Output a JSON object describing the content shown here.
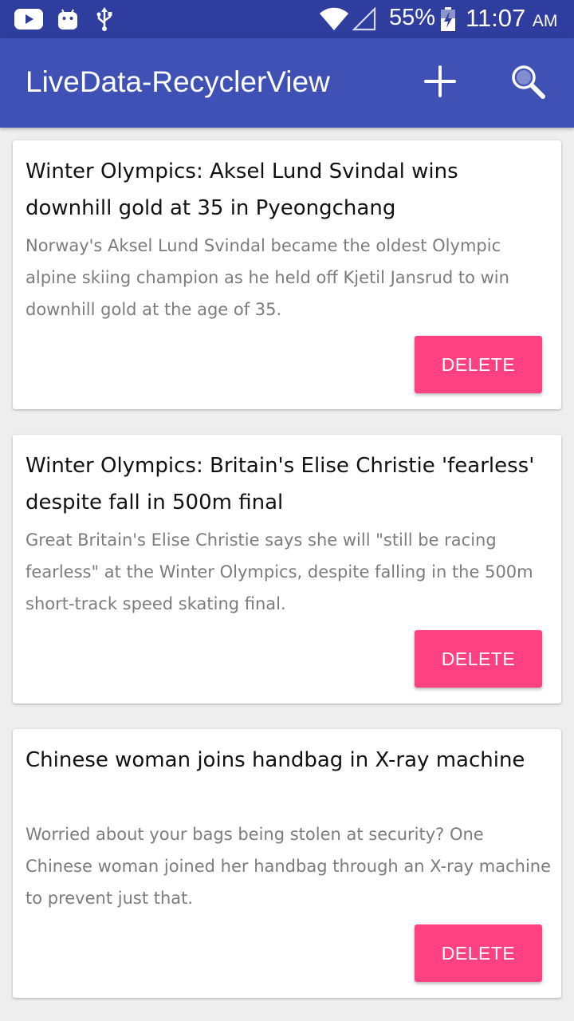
{
  "status_bar": {
    "icons": [
      "youtube-icon",
      "android-icon",
      "usb-icon",
      "wifi-icon",
      "signal-icon",
      "battery-icon"
    ],
    "battery_percent": "55%",
    "time": "11:07",
    "ampm": "AM"
  },
  "app_bar": {
    "title": "LiveData-RecyclerView",
    "actions": [
      "add-icon",
      "search-icon"
    ]
  },
  "articles": [
    {
      "title": "Winter Olympics: Aksel Lund Svindal wins downhill gold at 35 in Pyeongchang",
      "description": "Norway's Aksel Lund Svindal became the oldest Olympic alpine skiing champion as he held off Kjetil Jansrud to win downhill gold at the age of 35.",
      "delete_label": "DELETE"
    },
    {
      "title": "Winter Olympics: Britain's Elise Christie 'fearless' despite fall in 500m final",
      "description": "Great Britain's Elise Christie says she will \"still be racing fearless\" at the Winter Olympics, despite falling in the 500m short-track speed skating final.",
      "delete_label": "DELETE"
    },
    {
      "title": "Chinese woman joins handbag in X-ray machine",
      "description": "Worried about your bags being stolen at security? One Chinese woman joined her handbag through an X-ray machine to prevent just that.",
      "delete_label": "DELETE"
    }
  ],
  "colors": {
    "status_bar": "#2f3e9e",
    "app_bar": "#3f51b5",
    "accent": "#ff4081",
    "background": "#eeeeee"
  }
}
